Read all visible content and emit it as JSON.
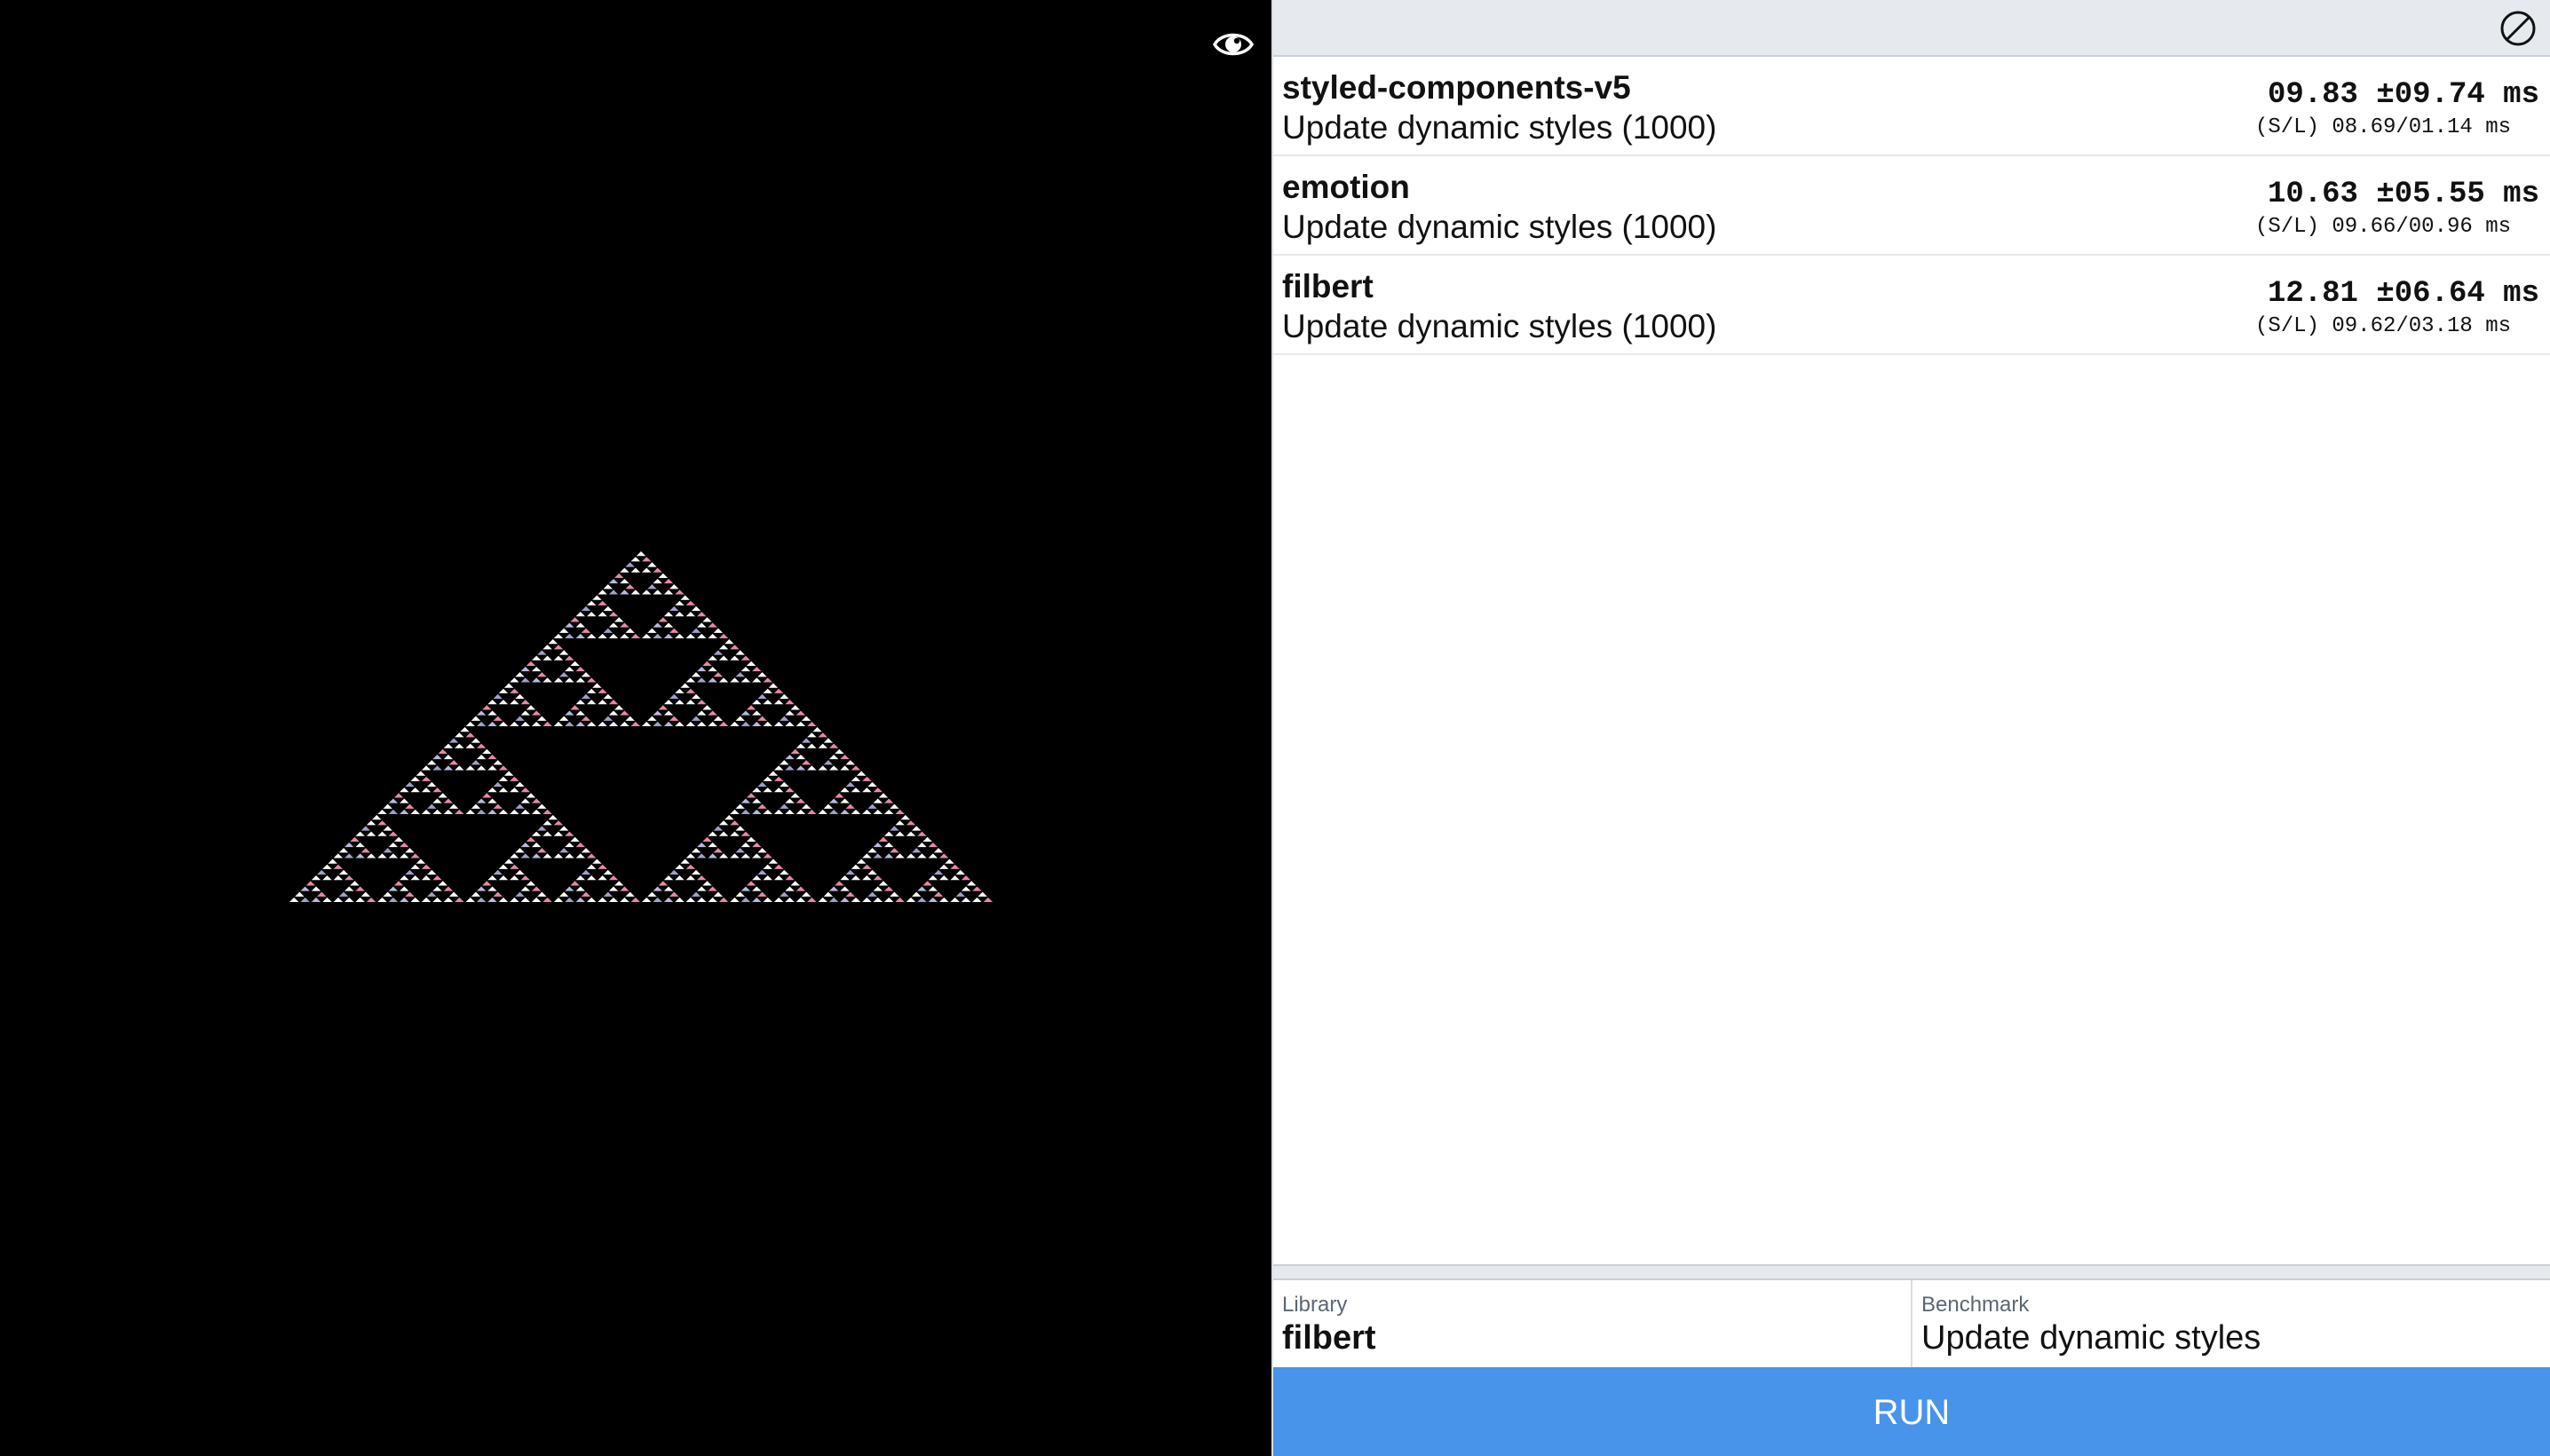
{
  "header": {
    "clear_icon": "clear-results-icon"
  },
  "viewer": {
    "toggle_icon": "eye-icon",
    "fractal_colors": [
      "#ffffff",
      "#ffffff",
      "#ffffff",
      "#b9b9de",
      "#e78aa3",
      "#ffffff",
      "#9ea2c7",
      "#ffffff"
    ]
  },
  "results": [
    {
      "library": "styled-components-v5",
      "benchmark": "Update dynamic styles (1000)",
      "mean": "09.83 ±09.74 ms",
      "sl": "(S/L) 08.69/01.14 ms"
    },
    {
      "library": "emotion",
      "benchmark": "Update dynamic styles (1000)",
      "mean": "10.63 ±05.55 ms",
      "sl": "(S/L) 09.66/00.96 ms"
    },
    {
      "library": "filbert",
      "benchmark": "Update dynamic styles (1000)",
      "mean": "12.81 ±06.64 ms",
      "sl": "(S/L) 09.62/03.18 ms"
    }
  ],
  "form": {
    "library_label": "Library",
    "library_value": "filbert",
    "benchmark_label": "Benchmark",
    "benchmark_value": "Update dynamic styles",
    "run_label": "RUN"
  },
  "colors": {
    "run_button": "#4794ea",
    "header_bg": "#e6eaee",
    "viewer_bg": "#000000"
  }
}
